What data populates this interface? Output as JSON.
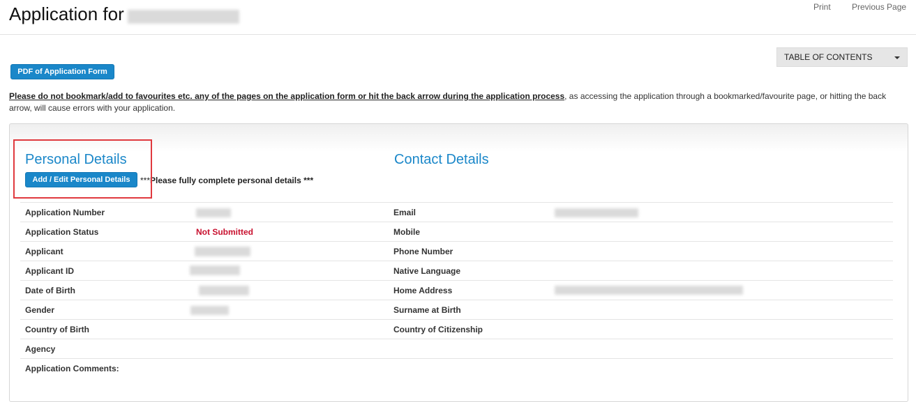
{
  "header": {
    "title": "Application for",
    "links": [
      "Print",
      "Previous Page"
    ]
  },
  "toc": {
    "label": "TABLE OF CONTENTS"
  },
  "pdf_button": "PDF of Application Form",
  "notice": {
    "bold": "Please do not bookmark/add to favourites etc. any of the pages on the application form or hit the back arrow during the application process",
    "rest": ", as accessing the application through a bookmarked/favourite page, or hitting the back arrow, will cause errors with your application."
  },
  "personal": {
    "title": "Personal Details",
    "edit_button": "Add / Edit Personal Details",
    "hint_stars_left": "***",
    "hint_text": "Please fully complete personal details ***"
  },
  "contact": {
    "title": "Contact Details"
  },
  "rows": [
    {
      "left_label": "Application Number",
      "left_value": "",
      "right_label": "Email"
    },
    {
      "left_label": "Application Status",
      "left_value": "Not Submitted",
      "right_label": "Mobile"
    },
    {
      "left_label": "Applicant",
      "left_value": "",
      "right_label": "Phone Number"
    },
    {
      "left_label": "Applicant ID",
      "left_value": "",
      "right_label": "Native Language"
    },
    {
      "left_label": "Date of Birth",
      "left_value": "",
      "right_label": "Home Address"
    },
    {
      "left_label": "Gender",
      "left_value": "",
      "right_label": "Surname at Birth"
    },
    {
      "left_label": "Country of Birth",
      "left_value": "",
      "right_label": "Country of Citizenship"
    },
    {
      "left_label": "Agency",
      "left_value": "",
      "right_label": ""
    },
    {
      "left_label": "Application Comments:",
      "left_value": "",
      "right_label": ""
    }
  ],
  "colors": {
    "accent": "#1a87c9",
    "status_red": "#c8102e",
    "highlight": "#e0393e"
  }
}
